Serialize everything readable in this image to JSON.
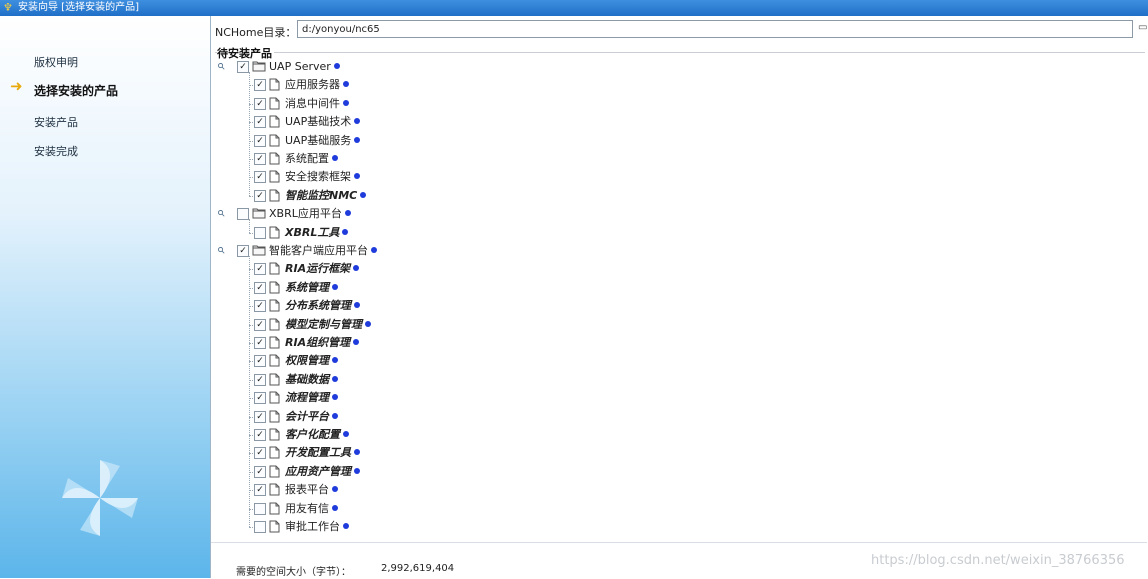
{
  "window": {
    "title": "安装向导  [选择安装的产品]"
  },
  "sidebar": {
    "steps": [
      {
        "label": "版权申明"
      },
      {
        "label": "选择安装的产品"
      },
      {
        "label": "安装产品"
      },
      {
        "label": "安装完成"
      }
    ]
  },
  "nchome": {
    "label": "NCHome目录：",
    "value": "d:/yonyou/nc65"
  },
  "products": {
    "group_label": "待安装产品",
    "items": [
      {
        "label": "UAP Server",
        "checked": true,
        "bold_italic": false
      },
      {
        "label": "应用服务器",
        "checked": true,
        "bold_italic": false
      },
      {
        "label": "消息中间件",
        "checked": true,
        "bold_italic": false
      },
      {
        "label": "UAP基础技术",
        "checked": true,
        "bold_italic": false
      },
      {
        "label": "UAP基础服务",
        "checked": true,
        "bold_italic": false
      },
      {
        "label": "系统配置",
        "checked": true,
        "bold_italic": false
      },
      {
        "label": "安全搜索框架",
        "checked": true,
        "bold_italic": false
      },
      {
        "label": "智能监控NMC",
        "checked": true,
        "bold_italic": true
      },
      {
        "label": "XBRL应用平台",
        "checked": false,
        "bold_italic": false
      },
      {
        "label": "XBRL工具",
        "checked": false,
        "bold_italic": true
      },
      {
        "label": "智能客户端应用平台",
        "checked": true,
        "bold_italic": false
      },
      {
        "label": "RIA运行框架",
        "checked": true,
        "bold_italic": true
      },
      {
        "label": "系统管理",
        "checked": true,
        "bold_italic": true
      },
      {
        "label": "分布系统管理",
        "checked": true,
        "bold_italic": true
      },
      {
        "label": "模型定制与管理",
        "checked": true,
        "bold_italic": true
      },
      {
        "label": "RIA组织管理",
        "checked": true,
        "bold_italic": true
      },
      {
        "label": "权限管理",
        "checked": true,
        "bold_italic": true
      },
      {
        "label": "基础数据",
        "checked": true,
        "bold_italic": true
      },
      {
        "label": "流程管理",
        "checked": true,
        "bold_italic": true
      },
      {
        "label": "会计平台",
        "checked": true,
        "bold_italic": true
      },
      {
        "label": "客户化配置",
        "checked": true,
        "bold_italic": true
      },
      {
        "label": "开发配置工具",
        "checked": true,
        "bold_italic": true
      },
      {
        "label": "应用资产管理",
        "checked": true,
        "bold_italic": true
      },
      {
        "label": "报表平台",
        "checked": true,
        "bold_italic": false
      },
      {
        "label": "用友有信",
        "checked": false,
        "bold_italic": false
      },
      {
        "label": "审批工作台",
        "checked": false,
        "bold_italic": false
      }
    ]
  },
  "footer": {
    "required_space_label": "需要的空间大小（字节）：",
    "required_space_value": "2,992,619,404",
    "watermark": "https://blog.csdn.net/weixin_38766356"
  },
  "colors": {
    "status_dot": "#1f3bdc",
    "titlebar": "#2a7fd8",
    "sidebar_bottom": "#5cb5ea"
  }
}
